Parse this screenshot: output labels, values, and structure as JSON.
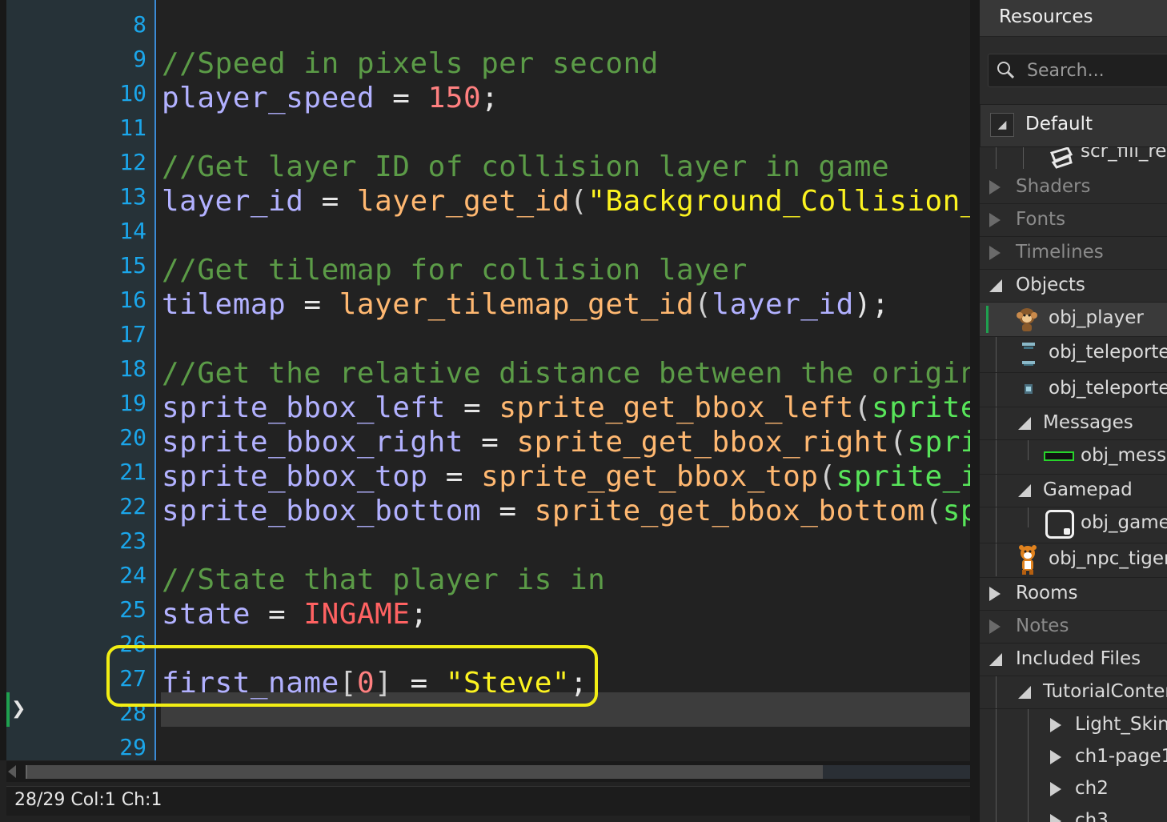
{
  "editor": {
    "lines": [
      {
        "n": "8",
        "tokens": []
      },
      {
        "n": "9",
        "tokens": [
          {
            "t": "//Speed in pixels per second",
            "c": "cm"
          }
        ]
      },
      {
        "n": "10",
        "tokens": [
          {
            "t": "player_speed",
            "c": "vr"
          },
          {
            "t": " = ",
            "c": "op"
          },
          {
            "t": "150",
            "c": "nm"
          },
          {
            "t": ";",
            "c": "op"
          }
        ]
      },
      {
        "n": "11",
        "tokens": []
      },
      {
        "n": "12",
        "tokens": [
          {
            "t": "//Get layer ID of collision layer in game",
            "c": "cm"
          }
        ]
      },
      {
        "n": "13",
        "tokens": [
          {
            "t": "layer_id",
            "c": "vr"
          },
          {
            "t": " = ",
            "c": "op"
          },
          {
            "t": "layer_get_id",
            "c": "fn"
          },
          {
            "t": "(",
            "c": "pa"
          },
          {
            "t": "\"Background_Collision_",
            "c": "st"
          }
        ]
      },
      {
        "n": "14",
        "tokens": []
      },
      {
        "n": "15",
        "tokens": [
          {
            "t": "//Get tilemap for collision layer",
            "c": "cm"
          }
        ]
      },
      {
        "n": "16",
        "tokens": [
          {
            "t": "tilemap",
            "c": "vr"
          },
          {
            "t": " = ",
            "c": "op"
          },
          {
            "t": "layer_tilemap_get_id",
            "c": "fn"
          },
          {
            "t": "(",
            "c": "pa"
          },
          {
            "t": "layer_id",
            "c": "vr"
          },
          {
            "t": ");",
            "c": "op"
          }
        ]
      },
      {
        "n": "17",
        "tokens": []
      },
      {
        "n": "18",
        "tokens": [
          {
            "t": "//Get the relative distance between the origin",
            "c": "cm"
          }
        ]
      },
      {
        "n": "19",
        "tokens": [
          {
            "t": "sprite_bbox_left",
            "c": "vr"
          },
          {
            "t": " = ",
            "c": "op"
          },
          {
            "t": "sprite_get_bbox_left",
            "c": "fn"
          },
          {
            "t": "(",
            "c": "pa"
          },
          {
            "t": "sprite",
            "c": "bi"
          }
        ]
      },
      {
        "n": "20",
        "tokens": [
          {
            "t": "sprite_bbox_right",
            "c": "vr"
          },
          {
            "t": " = ",
            "c": "op"
          },
          {
            "t": "sprite_get_bbox_right",
            "c": "fn"
          },
          {
            "t": "(",
            "c": "pa"
          },
          {
            "t": "spri",
            "c": "bi"
          }
        ]
      },
      {
        "n": "21",
        "tokens": [
          {
            "t": "sprite_bbox_top",
            "c": "vr"
          },
          {
            "t": " = ",
            "c": "op"
          },
          {
            "t": "sprite_get_bbox_top",
            "c": "fn"
          },
          {
            "t": "(",
            "c": "pa"
          },
          {
            "t": "sprite_i",
            "c": "bi"
          }
        ]
      },
      {
        "n": "22",
        "tokens": [
          {
            "t": "sprite_bbox_bottom",
            "c": "vr"
          },
          {
            "t": " = ",
            "c": "op"
          },
          {
            "t": "sprite_get_bbox_bottom",
            "c": "fn"
          },
          {
            "t": "(",
            "c": "pa"
          },
          {
            "t": "sp",
            "c": "bi"
          }
        ]
      },
      {
        "n": "23",
        "tokens": []
      },
      {
        "n": "24",
        "tokens": [
          {
            "t": "//State that player is in",
            "c": "cm"
          }
        ]
      },
      {
        "n": "25",
        "tokens": [
          {
            "t": "state",
            "c": "vr"
          },
          {
            "t": " = ",
            "c": "op"
          },
          {
            "t": "INGAME",
            "c": "cs"
          },
          {
            "t": ";",
            "c": "op"
          }
        ]
      },
      {
        "n": "26",
        "tokens": []
      },
      {
        "n": "27",
        "tokens": [
          {
            "t": "first_name",
            "c": "vr"
          },
          {
            "t": "[",
            "c": "pa"
          },
          {
            "t": "0",
            "c": "nm"
          },
          {
            "t": "]",
            "c": "pa"
          },
          {
            "t": " = ",
            "c": "op"
          },
          {
            "t": "\"Steve\"",
            "c": "st"
          },
          {
            "t": ";",
            "c": "op"
          }
        ]
      },
      {
        "n": "28",
        "tokens": []
      },
      {
        "n": "29",
        "tokens": []
      }
    ],
    "current_line": "28",
    "caret_glyph": "❯"
  },
  "status_bar": {
    "text": "28/29 Col:1 Ch:1"
  },
  "resources": {
    "title": "Resources",
    "search_placeholder": "Search...",
    "group": "Default",
    "scroll_partial": "scr_fill_res",
    "tree": {
      "shaders": "Shaders",
      "fonts": "Fonts",
      "timelines": "Timelines",
      "objects": "Objects",
      "obj_player": "obj_player",
      "obj_teleporter_1": "obj_teleporte",
      "obj_teleporter_2": "obj_teleporte",
      "messages": "Messages",
      "obj_message": "obj_messa",
      "gamepad": "Gamepad",
      "obj_gamepad": "obj_game",
      "obj_npc_tiger": "obj_npc_tiger",
      "rooms": "Rooms",
      "notes": "Notes",
      "included_files": "Included Files",
      "tutorial_content": "TutorialConter",
      "light_skin": "Light_Skin",
      "ch1_page1": "ch1-page1",
      "ch2": "ch2",
      "ch3": "ch3"
    }
  },
  "colors": {
    "line_numbers": "#1ba6ea",
    "comment": "#5b9b47",
    "variable": "#b2b1ff",
    "function": "#ffb871",
    "string": "#fcf320",
    "number": "#ff8080",
    "constant": "#ff6262",
    "builtin": "#58e55a",
    "highlight_box": "#f2ee14"
  }
}
